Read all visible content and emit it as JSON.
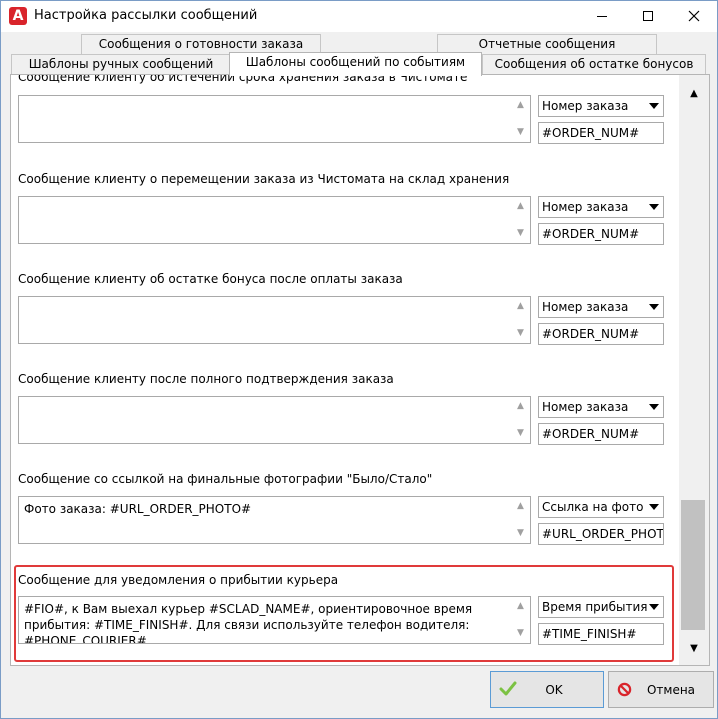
{
  "window": {
    "title": "Настройка рассылки сообщений",
    "app_icon_letter": "A"
  },
  "tabs": {
    "row1": [
      {
        "label": "Сообщения о готовности заказа"
      },
      {
        "label": "Отчетные сообщения"
      }
    ],
    "row2": [
      {
        "label": "Шаблоны ручных сообщений"
      },
      {
        "label": "Шаблоны сообщений по событиям",
        "active": true
      },
      {
        "label": "Сообщения об остатке бонусов"
      }
    ]
  },
  "sections": [
    {
      "label": "Сообщение клиенту об истечении срока хранения заказа в Чистомате",
      "text": "",
      "select": "Номер заказа",
      "token": "#ORDER_NUM#"
    },
    {
      "label": "Сообщение клиенту о перемещении заказа из Чистомата на склад хранения",
      "text": "",
      "select": "Номер заказа",
      "token": "#ORDER_NUM#"
    },
    {
      "label": "Сообщение клиенту об остатке бонуса после оплаты заказа",
      "text": "",
      "select": "Номер заказа",
      "token": "#ORDER_NUM#"
    },
    {
      "label": "Сообщение клиенту после полного подтверждения заказа",
      "text": "",
      "select": "Номер заказа",
      "token": "#ORDER_NUM#"
    },
    {
      "label": "Сообщение со ссылкой на финальные фотографии \"Было/Стало\"",
      "text": "Фото заказа: #URL_ORDER_PHOTO#",
      "select": "Ссылка на фото",
      "token": "#URL_ORDER_PHOTO#"
    },
    {
      "label": "Сообщение для уведомления о прибытии курьера",
      "text": "#FIO#, к Вам выехал курьер #SCLAD_NAME#, ориентировочное время прибытия: #TIME_FINISH#. Для связи используйте телефон водителя: #PHONE_COURIER#",
      "select": "Время прибытия",
      "token": "#TIME_FINISH#"
    }
  ],
  "buttons": {
    "ok_label": "OK",
    "cancel_label": "Отмена"
  },
  "colors": {
    "highlight": "#e03a3a",
    "ok_check": "#7cc243",
    "cancel_icon": "#d9242b"
  }
}
